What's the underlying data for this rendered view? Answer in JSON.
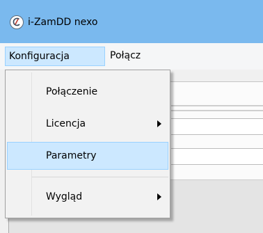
{
  "window": {
    "title": "i-ZamDD nexo",
    "icon": "app-logo-icon"
  },
  "menubar": {
    "items": [
      {
        "label": "Konfiguracja",
        "state": "open"
      },
      {
        "label": "Połącz"
      }
    ]
  },
  "dropdown": {
    "items": [
      {
        "label": "Połączenie",
        "submenu": false
      },
      {
        "label": "Licencja",
        "submenu": true,
        "submenu_icon": "chevron-right-icon"
      },
      {
        "label": "Parametry",
        "submenu": false,
        "state": "hovered"
      },
      {
        "label": "Wygląd",
        "submenu": true,
        "submenu_icon": "chevron-right-icon"
      }
    ]
  },
  "colors": {
    "titlebar": "#7ab9ee",
    "highlight": "#cce8ff",
    "highlight_border": "#99d1ff",
    "menu_background": "#f2f2f2"
  }
}
